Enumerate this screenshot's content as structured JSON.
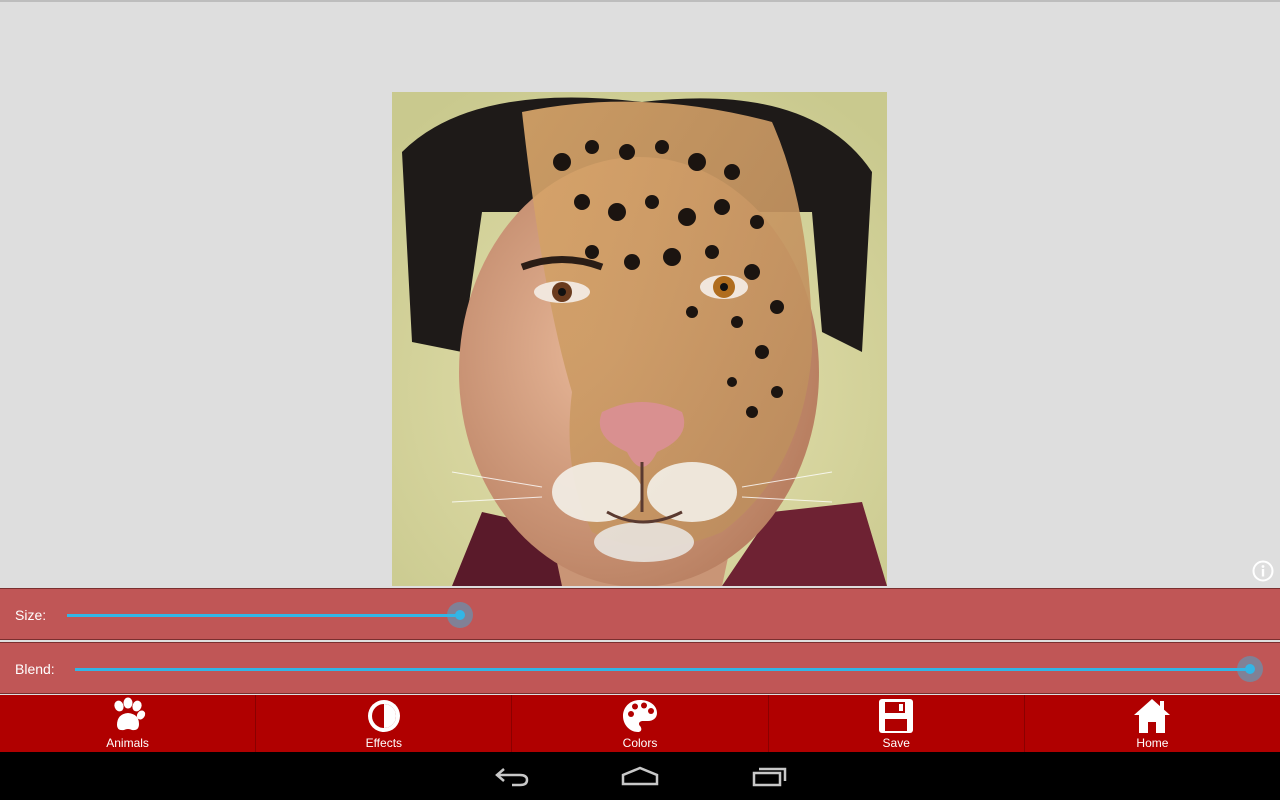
{
  "sliders": {
    "size": {
      "label": "Size:",
      "value": 0.345
    },
    "blend": {
      "label": "Blend:",
      "value": 1.0
    }
  },
  "toolbar": {
    "items": [
      {
        "label": "Animals",
        "icon": "paw-icon"
      },
      {
        "label": "Effects",
        "icon": "contrast-icon"
      },
      {
        "label": "Colors",
        "icon": "palette-icon"
      },
      {
        "label": "Save",
        "icon": "floppy-disk-icon"
      },
      {
        "label": "Home",
        "icon": "home-icon"
      }
    ]
  },
  "navbar": {
    "buttons": [
      "back-icon",
      "home-nav-icon",
      "recent-apps-icon"
    ]
  },
  "colors": {
    "background": "#dedede",
    "slider_panel": "#c05656",
    "toolbar": "#b00000",
    "accent": "#33b5e5",
    "navbar": "#000000"
  }
}
